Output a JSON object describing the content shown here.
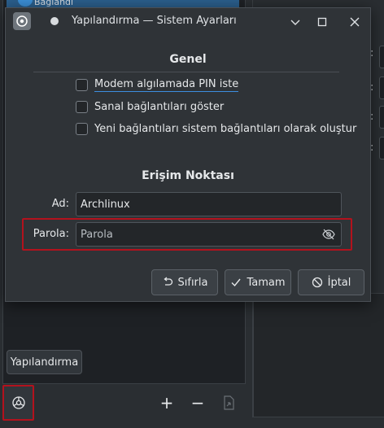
{
  "background": {
    "top_item_label": "Bağlandı",
    "configure_button": "Yapılandırma",
    "add_symbol": "+",
    "remove_symbol": "−",
    "right_colons": [
      ":",
      ":",
      ":",
      ":"
    ]
  },
  "dialog": {
    "title": "Yapılandırma — Sistem Ayarları",
    "general": {
      "heading": "Genel",
      "options": [
        {
          "label": "Modem algılamada PIN iste",
          "checked": false
        },
        {
          "label": "Sanal bağlantıları göster",
          "checked": false
        },
        {
          "label": "Yeni bağlantıları sistem bağlantıları olarak oluştur",
          "checked": false
        }
      ]
    },
    "hotspot": {
      "heading": "Erişim Noktası",
      "name_label": "Ad:",
      "name_value": "Archlinux",
      "password_label": "Parola:",
      "password_placeholder": "Parola"
    },
    "buttons": {
      "reset": "Sıfırla",
      "ok": "Tamam",
      "cancel": "İptal"
    }
  },
  "colors": {
    "highlight": "#b3121d",
    "focus": "#3d8ee0",
    "dialog_bg": "#2f3337"
  }
}
